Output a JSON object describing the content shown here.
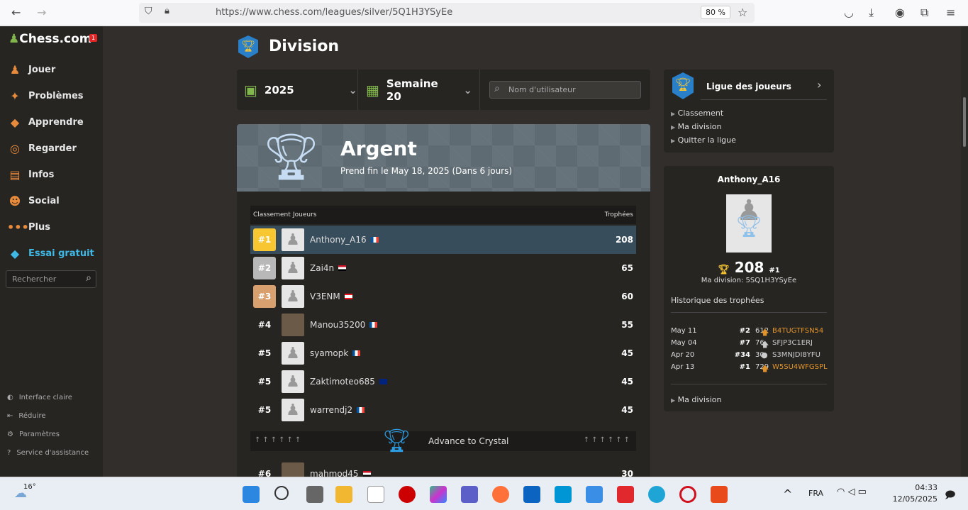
{
  "browser": {
    "url": "https://www.chess.com/leagues/silver/5Q1H3YSyEe",
    "zoom": "80 %"
  },
  "sidebar": {
    "logo": "Chess.com",
    "notif": "1",
    "items": [
      {
        "label": "Jouer",
        "icon": "♟"
      },
      {
        "label": "Problèmes",
        "icon": "✦"
      },
      {
        "label": "Apprendre",
        "icon": "◆"
      },
      {
        "label": "Regarder",
        "icon": "◎"
      },
      {
        "label": "Infos",
        "icon": "▤"
      },
      {
        "label": "Social",
        "icon": "☻"
      },
      {
        "label": "Plus",
        "icon": "•••"
      },
      {
        "label": "Essai gratuit",
        "icon": "◆"
      }
    ],
    "search": "Rechercher",
    "footer": [
      "Interface claire",
      "Réduire",
      "Paramètres",
      "Service d'assistance"
    ]
  },
  "page": {
    "title": "Division",
    "year": "2025",
    "week": "Semaine 20",
    "username_placeholder": "Nom d'utilisateur"
  },
  "banner": {
    "league": "Argent",
    "ends": "Prend fin le May 18, 2025 (Dans 6 jours)"
  },
  "table": {
    "headers": {
      "rank": "Classement",
      "players": "Joueurs",
      "trophies": "Trophées"
    },
    "rows": [
      {
        "rank": "#1",
        "name": "Anthony_A16",
        "trophies": "208",
        "medal": "#f7c631",
        "flag": "fr"
      },
      {
        "rank": "#2",
        "name": "Zai4n",
        "trophies": "65",
        "medal": "#b8b8b8",
        "flag": "eg"
      },
      {
        "rank": "#3",
        "name": "V3ENM",
        "trophies": "60",
        "medal": "#d89f6f",
        "flag": "lb"
      },
      {
        "rank": "#4",
        "name": "Manou35200",
        "trophies": "55",
        "flag": "fr",
        "photo": true
      },
      {
        "rank": "#5",
        "name": "syamopk",
        "trophies": "45",
        "flag": "fr"
      },
      {
        "rank": "#5",
        "name": "Zaktimoteo685",
        "trophies": "45",
        "flag": "au"
      },
      {
        "rank": "#5",
        "name": "warrendj2",
        "trophies": "45",
        "flag": "fr"
      }
    ],
    "advance": "Advance to Crystal",
    "below": [
      {
        "rank": "#6",
        "name": "mahmod45",
        "trophies": "30",
        "flag": "eg",
        "photo": true
      }
    ]
  },
  "league_panel": {
    "title": "Ligue des joueurs",
    "links": [
      "Classement",
      "Ma division",
      "Quitter la ligue"
    ]
  },
  "profile": {
    "name": "Anthony_A16",
    "trophies": "208",
    "rank": "#1",
    "division": "Ma division: 5SQ1H3YSyEe",
    "history_title": "Historique des trophées",
    "history": [
      {
        "date": "May 11",
        "rank": "#2",
        "score": "612",
        "code": "B4TUGTFSN54",
        "dir": "up",
        "color": "#e0932a"
      },
      {
        "date": "May 04",
        "rank": "#7",
        "score": "76",
        "code": "SFJP3C1ERJ",
        "dir": "up",
        "color": "#cccccc"
      },
      {
        "date": "Apr 20",
        "rank": "#34",
        "score": "30",
        "code": "S3MNJDI8YFU",
        "dir": "same",
        "color": "#cccccc"
      },
      {
        "date": "Apr 13",
        "rank": "#1",
        "score": "729",
        "code": "W5SU4WFGSPL",
        "dir": "up",
        "color": "#e0932a"
      }
    ],
    "link": "Ma division"
  },
  "taskbar": {
    "temp": "16°",
    "lang": "FRA",
    "time": "04:33",
    "date": "12/05/2025"
  }
}
